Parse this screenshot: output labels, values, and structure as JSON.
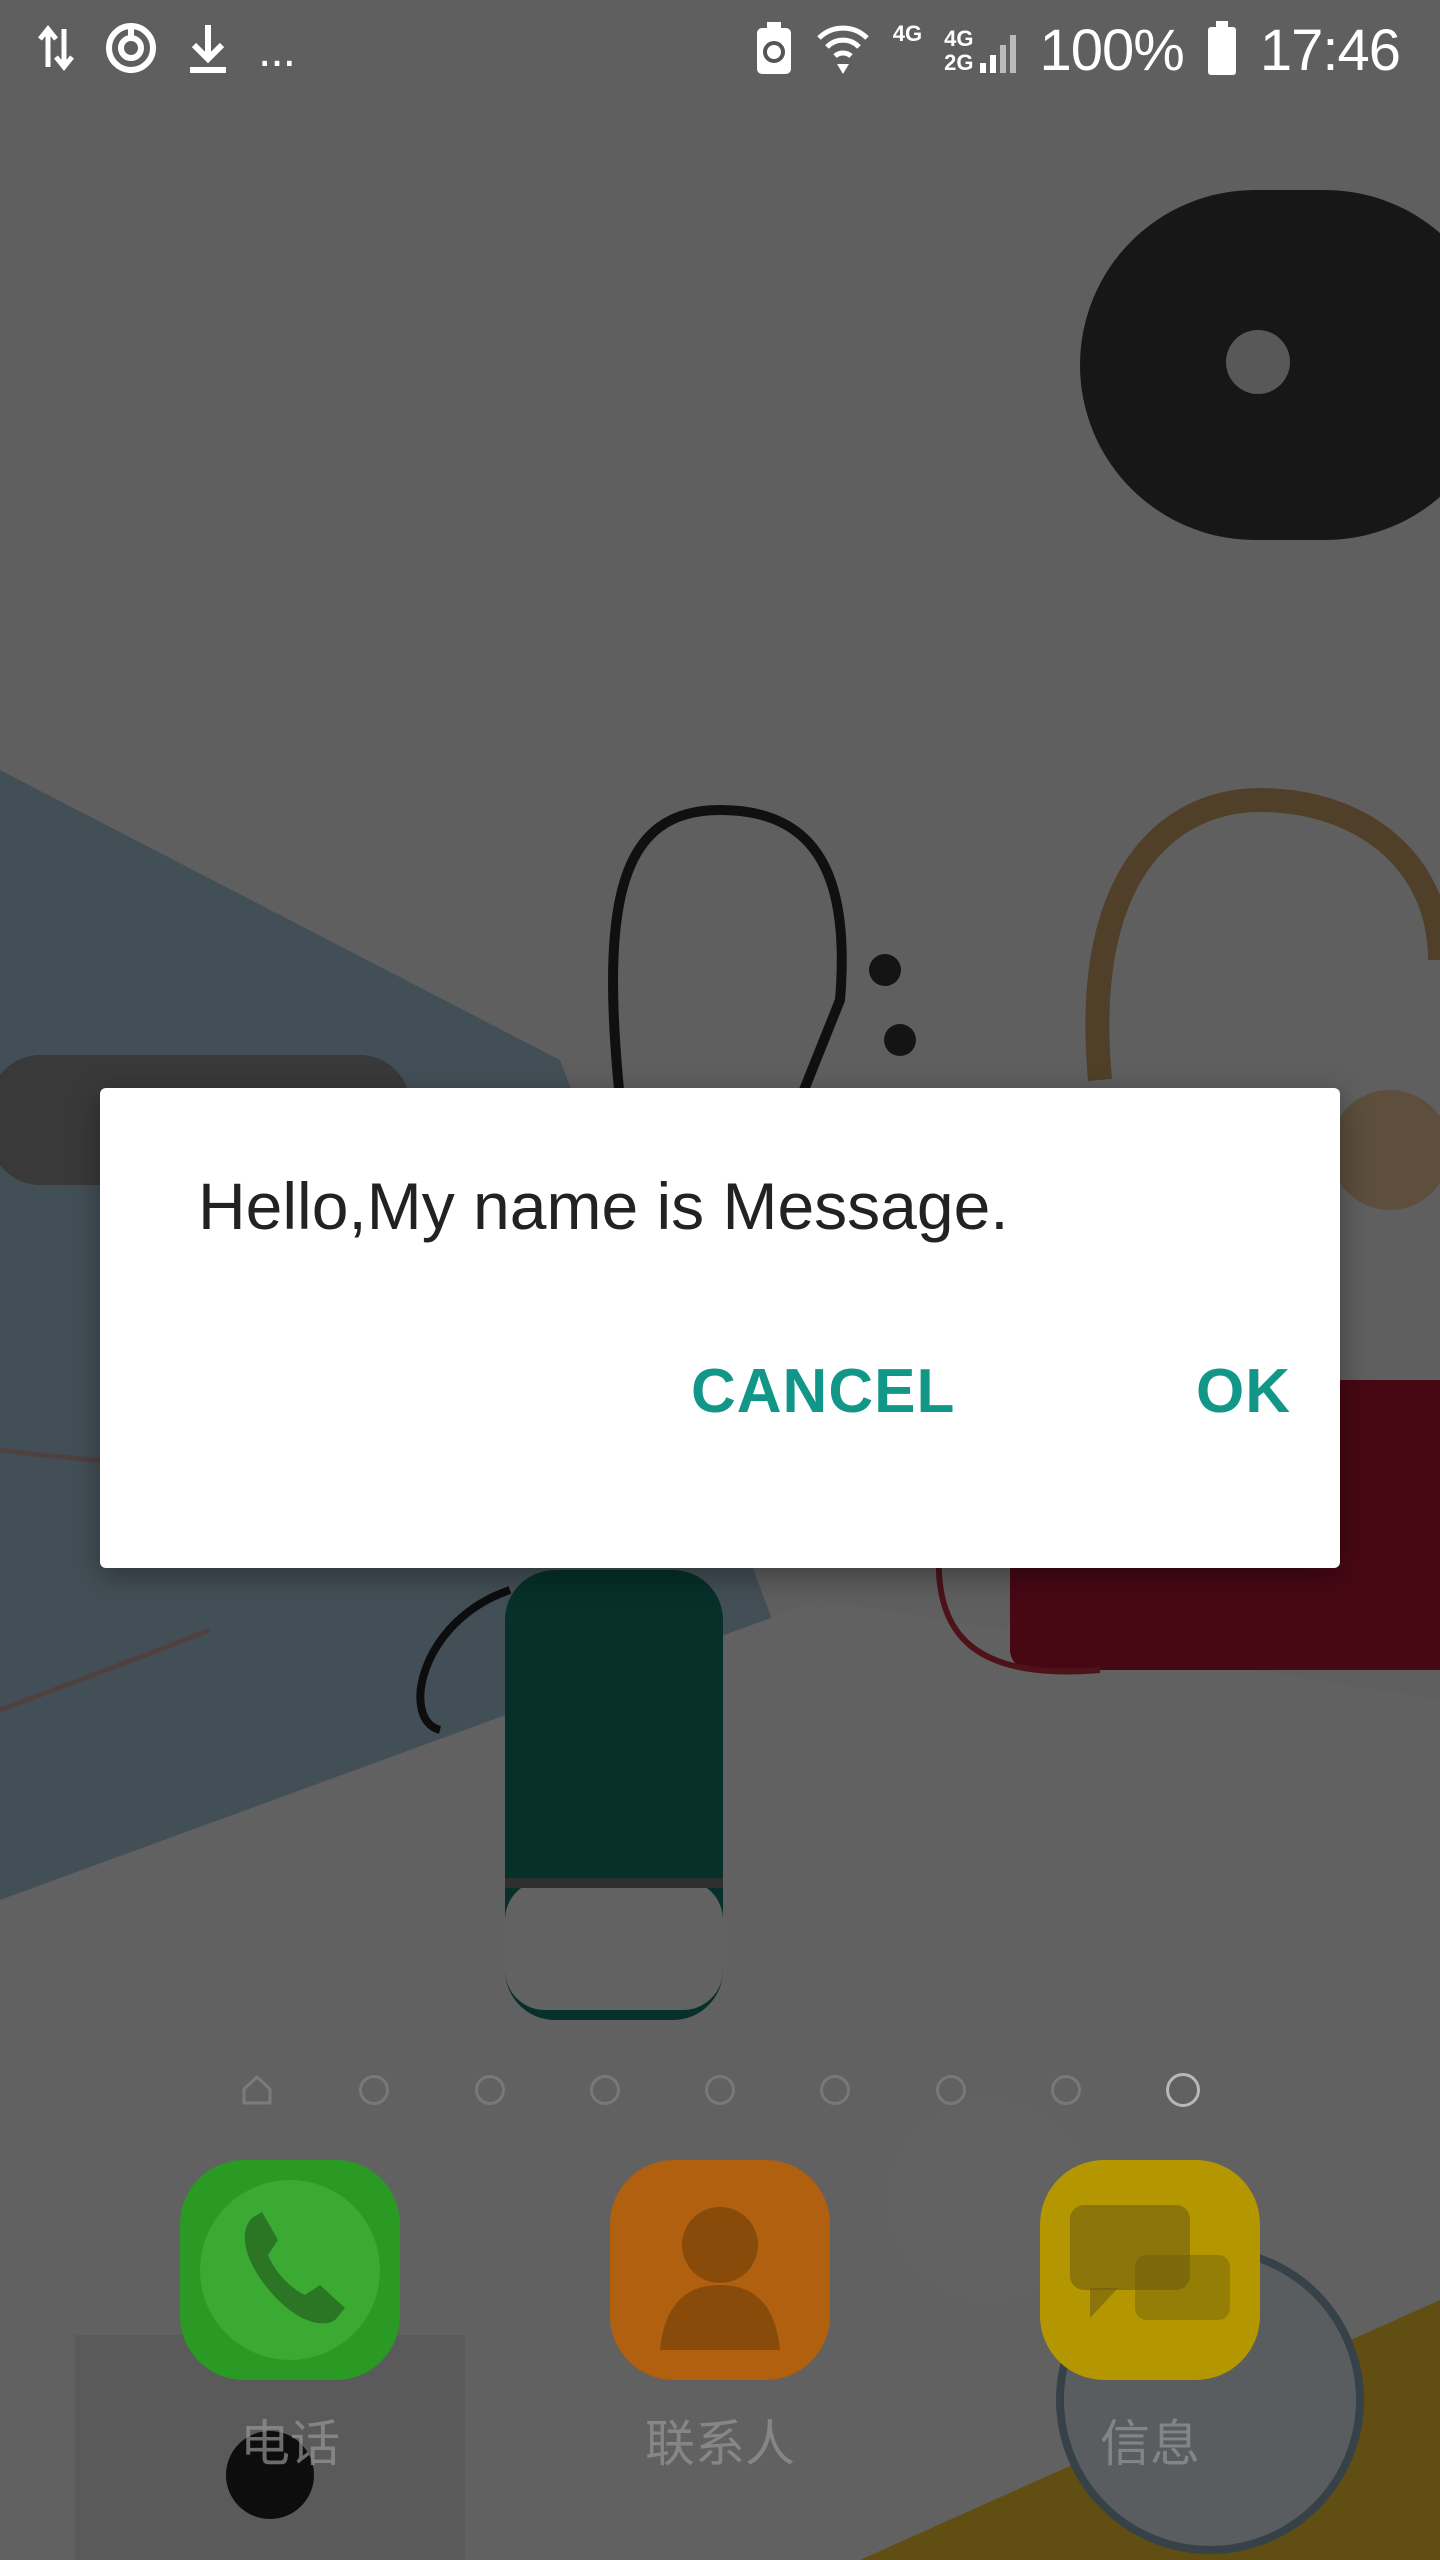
{
  "status_bar": {
    "icons_left": [
      "data-transfer-icon",
      "sync-icon",
      "download-icon",
      "more-notifications-icon"
    ],
    "more_text": "...",
    "icons_right": [
      "battery-saver-icon",
      "wifi-icon",
      "signal-4g-icon",
      "signal-4g-2g-icon"
    ],
    "net_4g": "4G",
    "net_4g_top": "4G",
    "net_2g_bottom": "2G",
    "battery_percent": "100%",
    "time": "17:46"
  },
  "dialog": {
    "message": "Hello,My name is Message.",
    "cancel_label": "CANCEL",
    "ok_label": "OK",
    "accent_color": "#129688"
  },
  "home": {
    "page_count": 9,
    "active_page": 9,
    "dock": [
      {
        "label": "电话",
        "icon": "phone-icon",
        "color": "#2a9a25"
      },
      {
        "label": "联系人",
        "icon": "contacts-icon",
        "color": "#c06a10"
      },
      {
        "label": "信息",
        "icon": "messages-icon",
        "color": "#c8a800"
      }
    ]
  }
}
